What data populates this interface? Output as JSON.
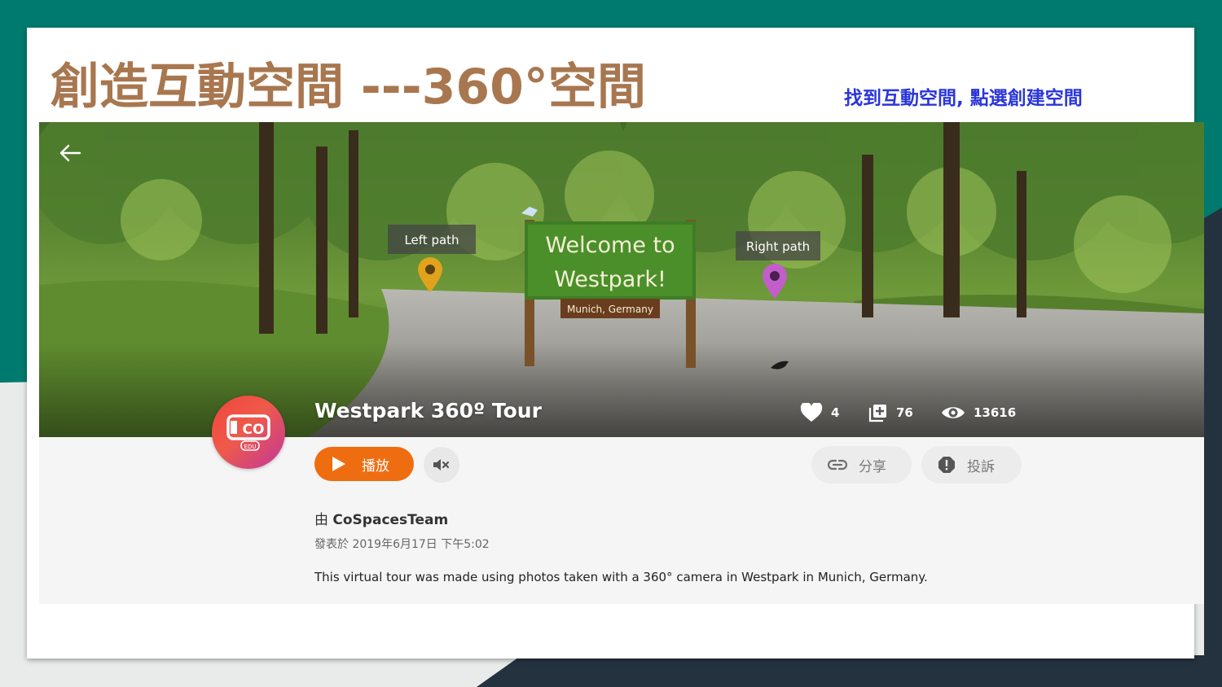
{
  "slide": {
    "title": "創造互動空間 ---360°空間",
    "note": "找到互動空間, 點選創建空間"
  },
  "scene": {
    "sign_title_line1": "Welcome to",
    "sign_title_line2": "Westpark!",
    "sign_subtitle": "Munich, Germany",
    "left_label": "Left path",
    "right_label": "Right path"
  },
  "space": {
    "title": "Westpark 360º Tour",
    "likes": "4",
    "remixes": "76",
    "views": "13616",
    "play_label": "播放",
    "share_label": "分享",
    "report_label": "投訴",
    "author_prefix": "由",
    "author": "CoSpacesTeam",
    "published": "發表於 2019年6月17日 下午5:02",
    "description": "This virtual tour was made using photos taken with a 360° camera in Westpark in Munich, Germany.",
    "avatar_text": "CO",
    "avatar_badge": "EDU"
  },
  "colors": {
    "title": "#a8774f",
    "note": "#2a36d9",
    "play": "#ef6d11",
    "teal": "#007a6e"
  }
}
